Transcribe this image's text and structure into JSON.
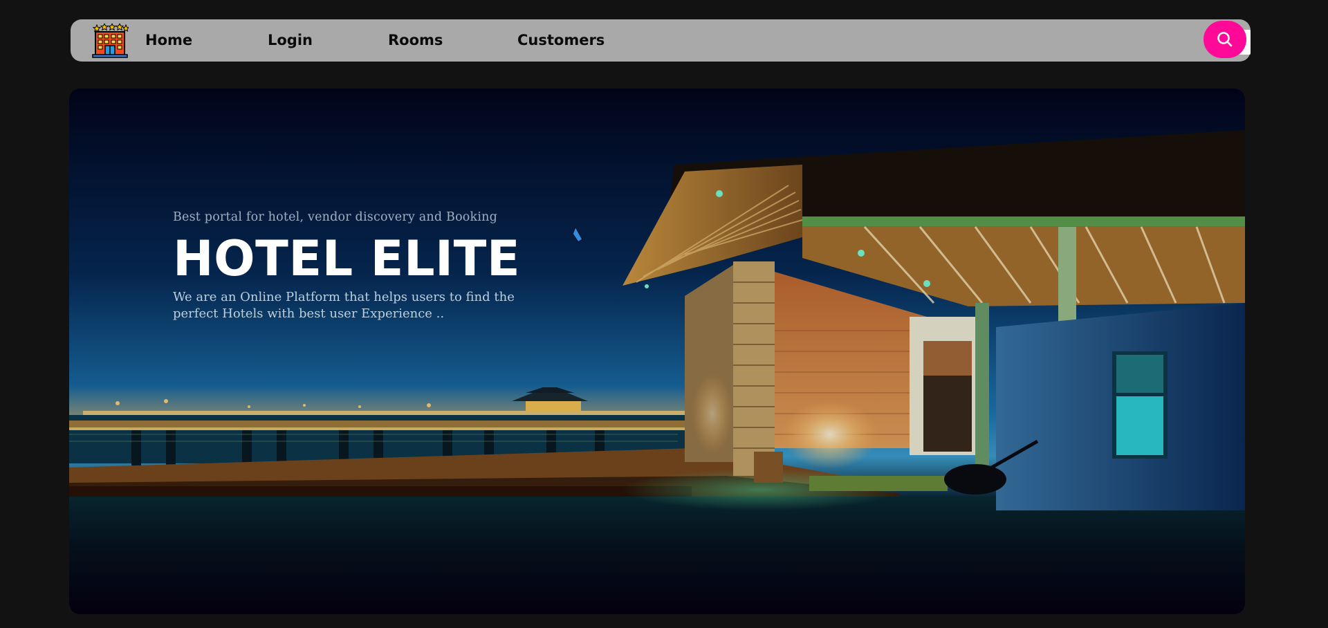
{
  "nav": {
    "logo_icon": "hotel-building-icon",
    "items": [
      {
        "label": "Home"
      },
      {
        "label": "Login"
      },
      {
        "label": "Rooms"
      },
      {
        "label": "Customers"
      }
    ],
    "search_icon": "search-icon"
  },
  "hero": {
    "tagline": "Best portal for hotel, vendor discovery and Booking",
    "title": "HOTEL ELITE",
    "description": "We are an Online Platform that helps users to find the perfect Hotels with best user Experience .."
  },
  "colors": {
    "page_background": "#121212",
    "navbar_background": "#a9a9a9",
    "search_button": "#ff0a98",
    "title_text": "#ffffff"
  }
}
